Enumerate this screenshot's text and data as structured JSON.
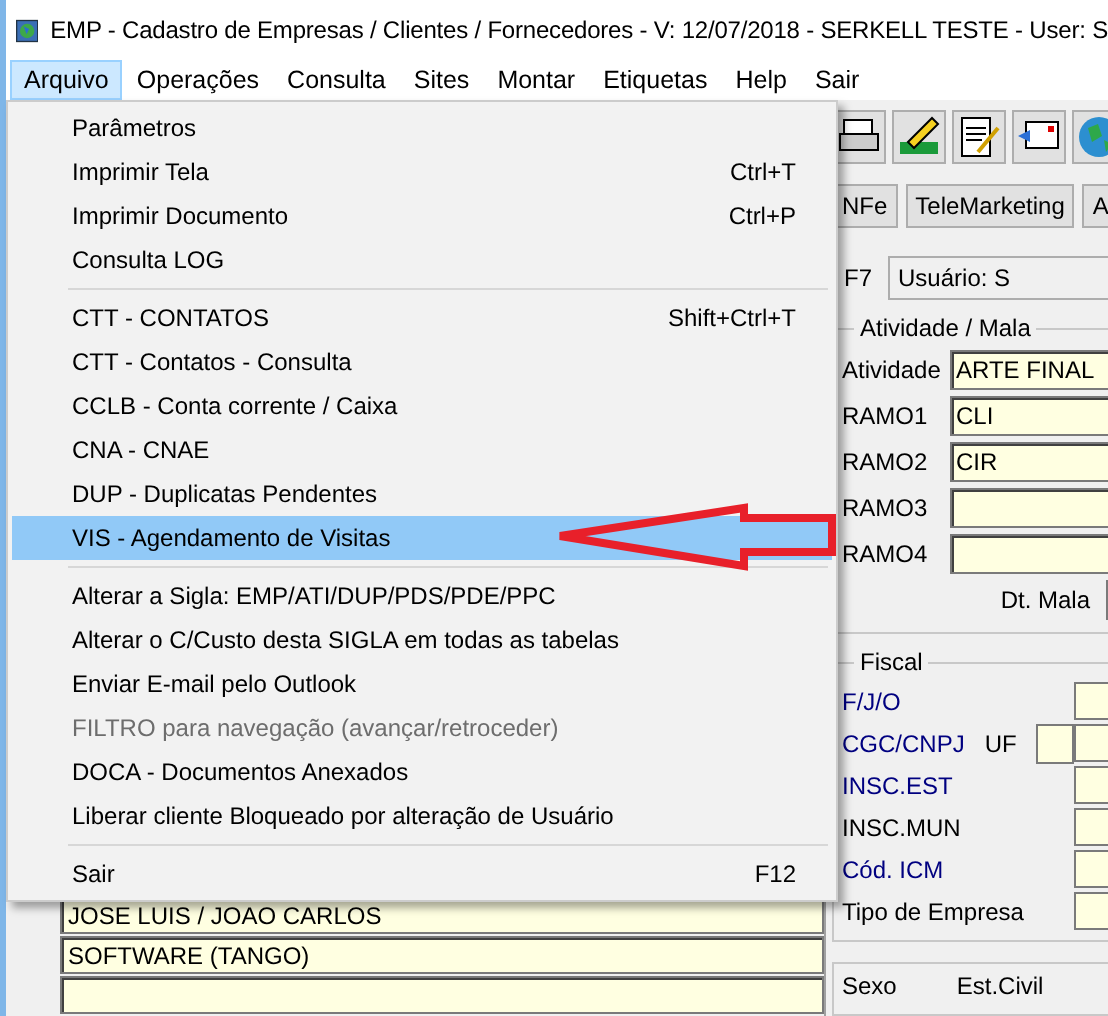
{
  "window": {
    "title": "EMP - Cadastro de Empresas / Clientes / Fornecedores - V: 12/07/2018 - SERKELL TESTE - User: S"
  },
  "menu_bar": [
    {
      "label": "Arquivo",
      "selected": true
    },
    {
      "label": "Operações",
      "selected": false
    },
    {
      "label": "Consulta",
      "selected": false
    },
    {
      "label": "Sites",
      "selected": false
    },
    {
      "label": "Montar",
      "selected": false
    },
    {
      "label": "Etiquetas",
      "selected": false
    },
    {
      "label": "Help",
      "selected": false
    },
    {
      "label": "Sair",
      "selected": false
    }
  ],
  "dropdown": {
    "items": [
      {
        "kind": "item",
        "label": "Parâmetros",
        "selected": false,
        "disabled": false
      },
      {
        "kind": "item",
        "label": "Imprimir Tela",
        "shortcut": "Ctrl+T",
        "selected": false,
        "disabled": false
      },
      {
        "kind": "item",
        "label": "Imprimir Documento",
        "shortcut": "Ctrl+P",
        "selected": false,
        "disabled": false
      },
      {
        "kind": "item",
        "label": "Consulta LOG",
        "selected": false,
        "disabled": false
      },
      {
        "kind": "separator"
      },
      {
        "kind": "item",
        "label": "CTT - CONTATOS",
        "shortcut": "Shift+Ctrl+T",
        "selected": false,
        "disabled": false
      },
      {
        "kind": "item",
        "label": "CTT - Contatos - Consulta",
        "selected": false,
        "disabled": false
      },
      {
        "kind": "item",
        "label": "CCLB - Conta corrente / Caixa",
        "selected": false,
        "disabled": false
      },
      {
        "kind": "item",
        "label": "CNA - CNAE",
        "selected": false,
        "disabled": false
      },
      {
        "kind": "item",
        "label": "DUP - Duplicatas Pendentes",
        "selected": false,
        "disabled": false
      },
      {
        "kind": "item",
        "label": "VIS - Agendamento de Visitas",
        "selected": true,
        "disabled": false
      },
      {
        "kind": "separator"
      },
      {
        "kind": "item",
        "label": "Alterar a Sigla: EMP/ATI/DUP/PDS/PDE/PPC",
        "selected": false,
        "disabled": false
      },
      {
        "kind": "item",
        "label": "Alterar o C/Custo desta SIGLA em todas as tabelas",
        "selected": false,
        "disabled": false
      },
      {
        "kind": "item",
        "label": "Enviar E-mail pelo Outlook",
        "selected": false,
        "disabled": false
      },
      {
        "kind": "item",
        "label": "FILTRO para navegação (avançar/retroceder)",
        "selected": false,
        "disabled": true
      },
      {
        "kind": "item",
        "label": "DOCA - Documentos Anexados",
        "selected": false,
        "disabled": false
      },
      {
        "kind": "item",
        "label": "Liberar cliente Bloqueado por alteração de Usuário",
        "selected": false,
        "disabled": false
      },
      {
        "kind": "separator"
      },
      {
        "kind": "item",
        "label": "Sair",
        "shortcut": "F12",
        "selected": false,
        "disabled": false
      }
    ]
  },
  "buttons": [
    "NFe",
    "TeleMarketing",
    "A"
  ],
  "shortcut_label": "F7",
  "user_field": "Usuário: S",
  "activity_group": {
    "title": "Atividade / Mala",
    "rows": [
      {
        "label": "Atividade",
        "value": "ARTE FINAL"
      },
      {
        "label": "RAMO1",
        "value": "CLI"
      },
      {
        "label": "RAMO2",
        "value": "CIR"
      },
      {
        "label": "RAMO3"
      },
      {
        "label": "RAMO4"
      }
    ],
    "date_label": "Dt. Mala"
  },
  "fiscal_group": {
    "title": "Fiscal",
    "uf_label": "UF",
    "rows": [
      {
        "label": "F/J/O",
        "color": "#000080"
      },
      {
        "label": "CGC/CNPJ",
        "color": "#000080"
      },
      {
        "label": "INSC.EST",
        "color": "#000080"
      },
      {
        "label": "INSC.MUN",
        "color": "#000000"
      },
      {
        "label": "Cód. ICM",
        "color": "#000080"
      },
      {
        "label": "Tipo de Empresa",
        "color": "#000000"
      }
    ]
  },
  "left_fields": [
    {
      "value": "JOSE LUIS / JOAO CARLOS"
    },
    {
      "value": "SOFTWARE (TANGO)"
    }
  ],
  "personal_group": {
    "labels": [
      "Sexo",
      "Est.Civil"
    ]
  }
}
